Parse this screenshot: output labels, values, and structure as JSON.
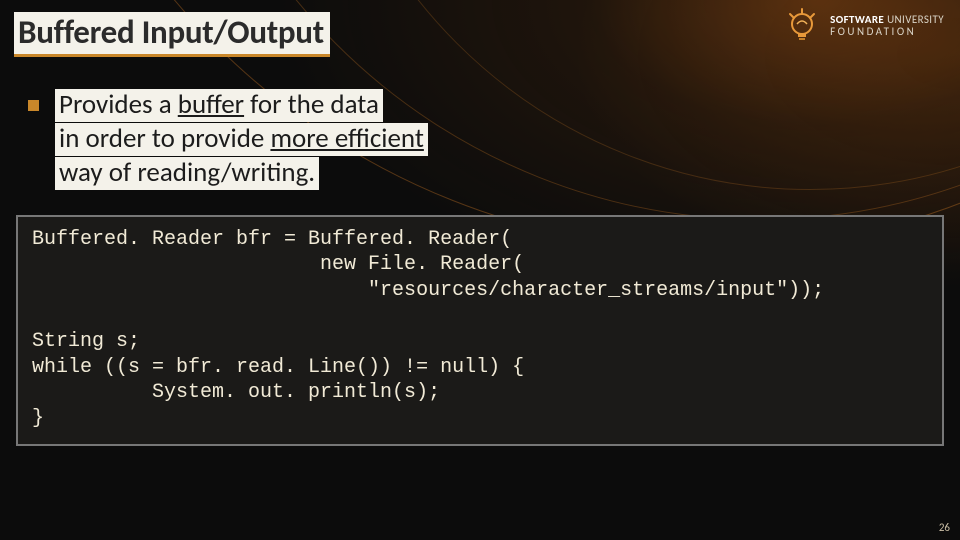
{
  "title": "Buffered Input/Output",
  "logo": {
    "line1a": "SOFTWARE",
    "line1b": " UNIVERSITY",
    "line2": "FOUNDATION"
  },
  "bullet": {
    "l1a": "Provides a ",
    "l1b": "buffer",
    "l1c": " for the data",
    "l2a": "in order to provide ",
    "l2b": "more efficient",
    "l3": "way of reading/writing."
  },
  "code": "Buffered. Reader bfr = Buffered. Reader(\n                        new File. Reader(\n                            \"resources/character_streams/input\"));\n\nString s;\nwhile ((s = bfr. read. Line()) != null) {\n          System. out. println(s);\n}",
  "page_number": "26"
}
